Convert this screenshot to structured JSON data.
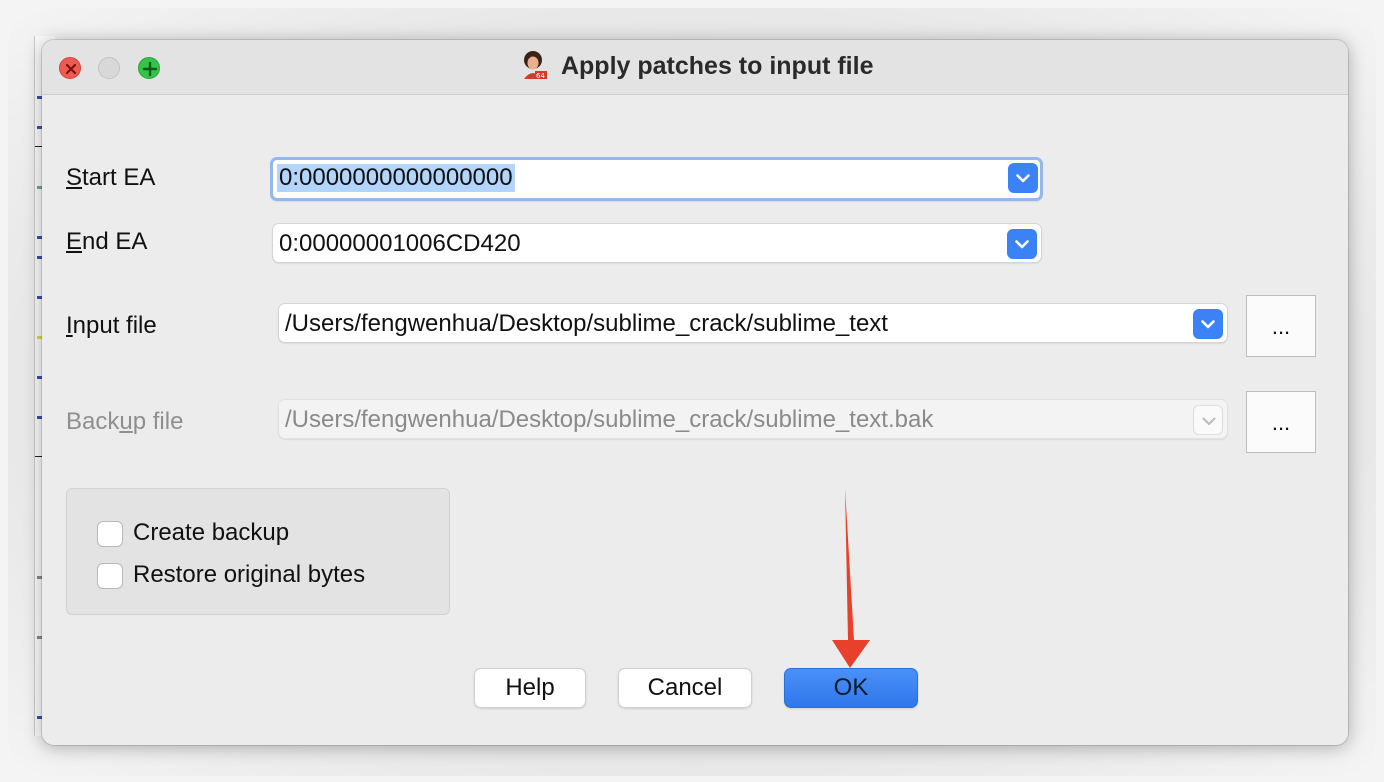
{
  "window": {
    "title": "Apply patches to input file",
    "app_icon": "ida-pro-icon",
    "controls": [
      "close",
      "minimize",
      "zoom"
    ]
  },
  "fields": {
    "start_ea": {
      "label": "Start EA",
      "value": "0:0000000000000000",
      "selected": true
    },
    "end_ea": {
      "label": "End EA",
      "value": "0:00000001006CD420"
    },
    "input_file": {
      "label": "Input file",
      "value": "/Users/fengwenhua/Desktop/sublime_crack/sublime_text",
      "browse_label": "..."
    },
    "backup_file": {
      "label": "Backup file",
      "value": "/Users/fengwenhua/Desktop/sublime_crack/sublime_text.bak",
      "browse_label": "...",
      "disabled": true
    }
  },
  "options": {
    "create_backup": {
      "label": "Create backup",
      "checked": false
    },
    "restore_original": {
      "label": "Restore original bytes",
      "checked": false
    }
  },
  "buttons": {
    "help": "Help",
    "cancel": "Cancel",
    "ok": "OK"
  },
  "annotation": {
    "type": "red-arrow",
    "points_to": "ok-button",
    "color": "#e8402a"
  },
  "colors": {
    "accent": "#3b82f6",
    "selection": "#b3d4fb",
    "window_bg": "#ececec"
  }
}
